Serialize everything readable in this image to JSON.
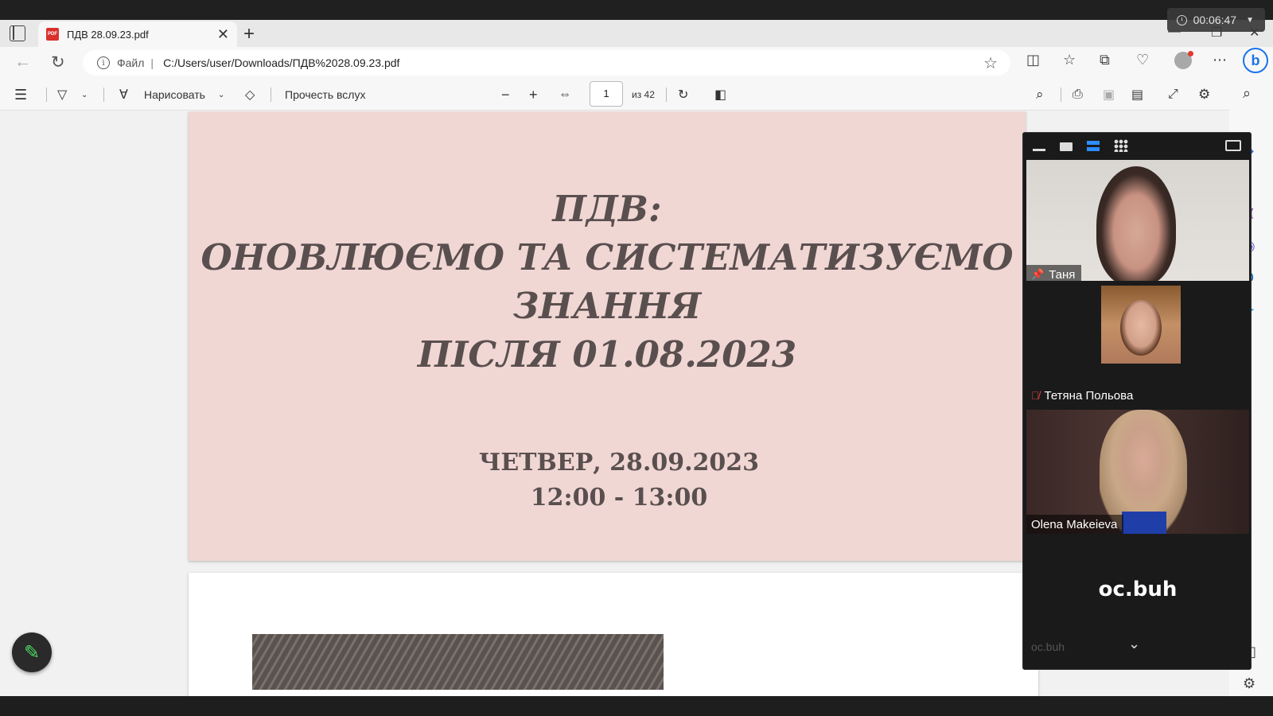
{
  "timer": {
    "elapsed": "00:06:47"
  },
  "tab": {
    "title": "ПДВ 28.09.23.pdf",
    "icon": "pdf-icon"
  },
  "address": {
    "scheme": "Файл",
    "url": "C:/Users/user/Downloads/ПДВ%2028.09.23.pdf"
  },
  "pdf_toolbar": {
    "draw_label": "Нарисовать",
    "read_aloud_label": "Прочесть вслух",
    "page_current": "1",
    "page_total": "из 42"
  },
  "slide": {
    "title_lines": [
      "ПДВ:",
      "ОНОВЛЮЄМО ТА СИСТЕМАТИЗУЄМО",
      "ЗНАННЯ",
      "ПІСЛЯ 01.08.2023"
    ],
    "date_line": "ЧЕТВЕР, 28.09.2023",
    "time_line": "12:00 - 13:00"
  },
  "meeting": {
    "participants": [
      {
        "name": "Таня",
        "status": "pinned"
      },
      {
        "name": "Тетяна Польова",
        "status": "muted"
      },
      {
        "name": "Olena Makeieva",
        "status": "speaking"
      },
      {
        "name": "oc.buh",
        "status": "video-off"
      }
    ]
  },
  "colors": {
    "slide_bg": "#f0d7d4",
    "slide_text": "#5a4f4f",
    "muted_red": "#e0443e",
    "zoom_blue": "#2d8cff"
  }
}
